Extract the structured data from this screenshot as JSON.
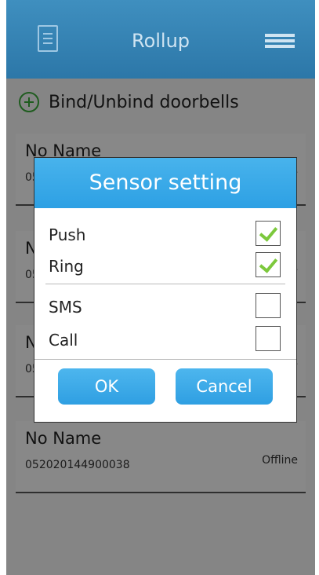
{
  "header": {
    "title": "Rollup",
    "left_icon": "document-icon",
    "right_icon": "menu-icon"
  },
  "bind": {
    "label": "Bind/Unbind doorbells",
    "icon": "plus-circle-icon",
    "icon_color": "#3aa83a"
  },
  "devices": [
    {
      "name": "No Name",
      "id": "05",
      "status": "ne"
    },
    {
      "name": "N",
      "id": "05",
      "status": "ne"
    },
    {
      "name": "N",
      "id": "05",
      "status": "ne"
    },
    {
      "name": "No Name",
      "id": "052020144900038",
      "status": "Offline"
    }
  ],
  "dialog": {
    "title": "Sensor setting",
    "options": [
      {
        "label": "Push",
        "checked": true
      },
      {
        "label": "Ring",
        "checked": true
      },
      {
        "label": "SMS",
        "checked": false
      },
      {
        "label": "Call",
        "checked": false
      }
    ],
    "ok_label": "OK",
    "cancel_label": "Cancel"
  },
  "colors": {
    "header": "#2f7aab",
    "accent": "#2da0e4",
    "check": "#7cc83c"
  }
}
